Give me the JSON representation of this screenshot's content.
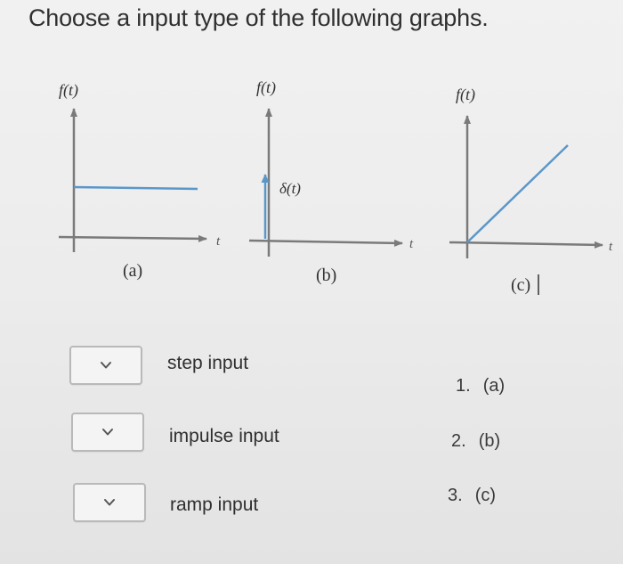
{
  "question": {
    "title": "Choose a input type of the following graphs."
  },
  "graphs": [
    {
      "id": "a",
      "y_label": "f(t)",
      "x_label": "t",
      "caption": "(a)",
      "signal_label": ""
    },
    {
      "id": "b",
      "y_label": "f(t)",
      "x_label": "t",
      "caption": "(b)",
      "signal_label": "δ(t)"
    },
    {
      "id": "c",
      "y_label": "f(t)",
      "x_label": "t",
      "caption": "(c)",
      "signal_label": ""
    }
  ],
  "colors": {
    "signal": "#5a97c9",
    "axis": "#7a7a7a",
    "text": "#2f2f2f"
  },
  "matches": [
    {
      "statement": "step input",
      "selected": ""
    },
    {
      "statement": "impulse input",
      "selected": ""
    },
    {
      "statement": "ramp input",
      "selected": ""
    }
  ],
  "answers": [
    {
      "number": "1.",
      "label": "(a)"
    },
    {
      "number": "2.",
      "label": "(b)"
    },
    {
      "number": "3.",
      "label": "(c)"
    }
  ],
  "icons": {
    "dropdown": "chevron-down-icon"
  }
}
